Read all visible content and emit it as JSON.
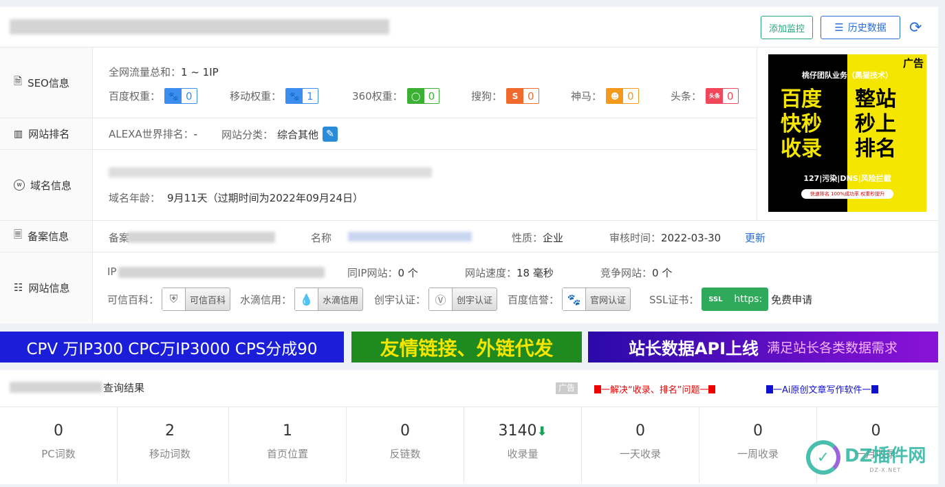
{
  "header": {
    "add_monitor": "添加监控",
    "history": "历史数据"
  },
  "seo": {
    "label": "SEO信息",
    "traffic_label": "全网流量总和：",
    "traffic_value": "1 ~ 1IP",
    "weights": [
      {
        "label": "百度权重：",
        "value": "0",
        "icon": "paw-icon",
        "color": "#3b8ef0"
      },
      {
        "label": "移动权重：",
        "value": "1",
        "icon": "paw-icon",
        "color": "#3b8ef0"
      },
      {
        "label": "360权重：",
        "value": "0",
        "icon": "360-icon",
        "color": "#3cb034"
      },
      {
        "label": "搜狗：",
        "value": "0",
        "icon": "sogou-icon",
        "color": "#f06a2e"
      },
      {
        "label": "神马：",
        "value": "0",
        "icon": "shenma-icon",
        "color": "#f39a1d"
      },
      {
        "label": "头条：",
        "value": "0",
        "icon": "toutiao-icon",
        "color": "#f0485a"
      }
    ]
  },
  "rank": {
    "label": "网站排名",
    "alexa_label": "ALEXA世界排名：",
    "alexa_value": "-",
    "category_label": "网站分类：",
    "category_value": "综合其他"
  },
  "domain": {
    "label": "域名信息",
    "age_label": "域名年龄：",
    "age_value": "9月11天（过期时间为2022年09月24日）"
  },
  "beian": {
    "label": "备案信息",
    "prefix": "备案",
    "name_label": "名称",
    "nature_label": "性质：",
    "nature_value": "企业",
    "audit_label": "审核时间：",
    "audit_value": "2022-03-30",
    "update_link": "更新"
  },
  "site": {
    "label": "网站信息",
    "ip_prefix": "IP",
    "same_ip_label": "同IP网站：",
    "same_ip_value": "0 个",
    "speed_label": "网站速度：",
    "speed_value": "18 毫秒",
    "compete_label": "竞争网站：",
    "compete_value": "0 个",
    "certs": [
      {
        "label": "可信百科：",
        "badge": "可信百科"
      },
      {
        "label": "水滴信用：",
        "badge": "水滴信用"
      },
      {
        "label": "创宇认证：",
        "badge": "创宇认证"
      },
      {
        "label": "百度信誉：",
        "badge": "官网认证"
      }
    ],
    "ssl_label": "SSL证书：",
    "ssl_badge": "https:",
    "ssl_free": "免费申请"
  },
  "ad": {
    "tag": "广告",
    "line1": "桃仔团队业务（黑猫技术）",
    "col1": [
      "百度",
      "快秒",
      "收录"
    ],
    "col2": [
      "整站",
      "秒上",
      "排名"
    ],
    "line2": "127|污染|DNS|风险拦截",
    "line3": "快速排名 100%成功率 权重秒提升"
  },
  "banners": [
    {
      "text": "CPV 万IP300 CPC万IP3000 CPS分成90"
    },
    {
      "text": "友情链接、外链代发"
    },
    {
      "text": "站长数据API上线",
      "sub": "满足站长各类数据需求"
    }
  ],
  "results": {
    "title_suffix": "查询结果",
    "ad_tag": "广告",
    "link1": "一解决“收录、排名”问题一",
    "link2": "一Ai原创文章写作软件一",
    "stats": [
      {
        "value": "0",
        "label": "PC词数"
      },
      {
        "value": "2",
        "label": "移动词数"
      },
      {
        "value": "1",
        "label": "首页位置"
      },
      {
        "value": "0",
        "label": "反链数"
      },
      {
        "value": "3140",
        "label": "收录量"
      },
      {
        "value": "0",
        "label": "一天收录"
      },
      {
        "value": "0",
        "label": "一周收录"
      },
      {
        "value": "0",
        "label": "一月收录"
      }
    ]
  },
  "watermark": {
    "brand": "DZ插件网",
    "url": "DZ-X.NET"
  }
}
